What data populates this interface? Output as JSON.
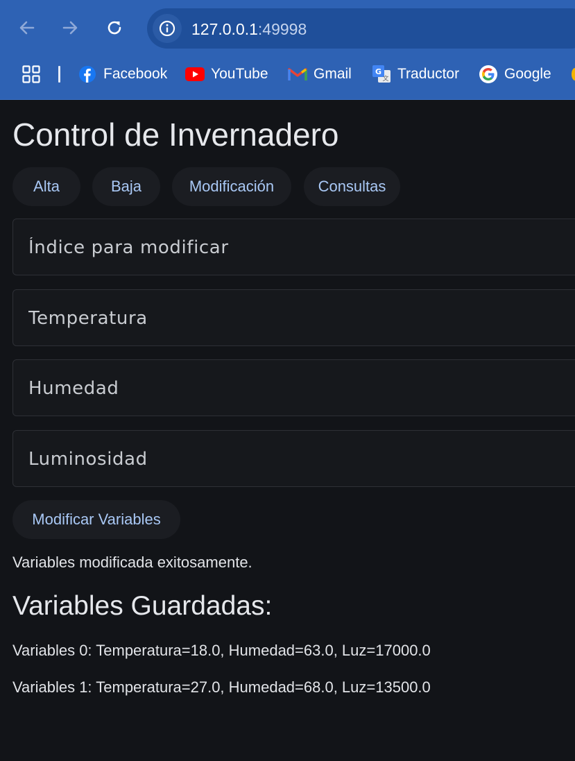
{
  "browser": {
    "url_host": "127.0.0.1",
    "url_port": ":49998",
    "bookmarks": [
      {
        "label": "Facebook",
        "icon": "facebook-icon"
      },
      {
        "label": "YouTube",
        "icon": "youtube-icon"
      },
      {
        "label": "Gmail",
        "icon": "gmail-icon"
      },
      {
        "label": "Traductor",
        "icon": "translate-icon"
      },
      {
        "label": "Google",
        "icon": "google-icon"
      }
    ],
    "colors": {
      "toolbar": "#2e62b4",
      "omnibox": "#1f4f9a"
    }
  },
  "page": {
    "title": "Control de Invernadero",
    "tabs": [
      {
        "label": "Alta"
      },
      {
        "label": "Baja"
      },
      {
        "label": "Modificación"
      },
      {
        "label": "Consultas"
      }
    ],
    "fields": {
      "index": {
        "placeholder": "Índice para modificar",
        "value": ""
      },
      "temperature": {
        "placeholder": "Temperatura",
        "value": ""
      },
      "humidity": {
        "placeholder": "Humedad",
        "value": ""
      },
      "luminosity": {
        "placeholder": "Luminosidad",
        "value": ""
      }
    },
    "submit_label": "Modificar Variables",
    "status_message": "Variables modificada exitosamente.",
    "saved_heading": "Variables Guardadas:",
    "records": [
      "Variables 0: Temperatura=18.0, Humedad=63.0, Luz=17000.0",
      "Variables 1: Temperatura=27.0, Humedad=68.0, Luz=13500.0"
    ],
    "colors": {
      "background": "#121418",
      "accent_text": "#a9c8f5",
      "button_bg": "#1b1d22"
    }
  }
}
